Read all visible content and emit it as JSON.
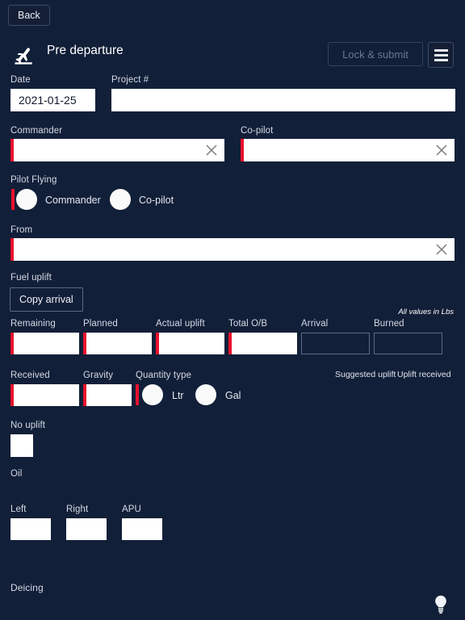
{
  "nav": {
    "back_label": "Back"
  },
  "header": {
    "icon": "flight-takeoff-icon",
    "title": "Pre departure",
    "lock_submit_label": "Lock & submit",
    "menu_icon": "hamburger-menu-icon"
  },
  "form": {
    "date": {
      "label": "Date",
      "value": "2021-01-25",
      "placeholder": ""
    },
    "project": {
      "label": "Project #",
      "value": "",
      "placeholder": ""
    },
    "commander": {
      "label": "Commander",
      "value": "",
      "placeholder": "",
      "clear_icon": "close-icon"
    },
    "copilot": {
      "label": "Co-pilot",
      "value": "",
      "placeholder": "",
      "clear_icon": "close-icon"
    },
    "pilot_flying": {
      "label": "Pilot Flying",
      "options": [
        {
          "label": "Commander",
          "selected": false
        },
        {
          "label": "Co-pilot",
          "selected": false
        }
      ]
    },
    "from": {
      "label": "From",
      "value": "",
      "placeholder": "",
      "clear_icon": "close-icon"
    }
  },
  "fuel": {
    "section_label": "Fuel uplift",
    "copy_arrival_label": "Copy arrival",
    "units_note": "All values in Lbs",
    "fields": [
      {
        "label": "Remaining",
        "value": "",
        "readonly": false
      },
      {
        "label": "Planned",
        "value": "",
        "readonly": false
      },
      {
        "label": "Actual uplift",
        "value": "",
        "readonly": false
      },
      {
        "label": "Total O/B",
        "value": "",
        "readonly": false
      },
      {
        "label": "Arrival",
        "value": "",
        "readonly": true
      },
      {
        "label": "Burned",
        "value": "",
        "readonly": true
      }
    ],
    "received": {
      "label": "Received",
      "value": ""
    },
    "gravity": {
      "label": "Gravity",
      "value": ""
    },
    "quantity_type": {
      "label": "Quantity type",
      "options": [
        {
          "label": "Ltr",
          "selected": false
        },
        {
          "label": "Gal",
          "selected": false
        }
      ]
    },
    "suggested_uplift_label": "Suggested uplift",
    "uplift_received_label": "Uplift received",
    "no_uplift": {
      "label": "No uplift",
      "checked": false
    }
  },
  "oil": {
    "section_label": "Oil",
    "fields": [
      {
        "label": "Left",
        "value": ""
      },
      {
        "label": "Right",
        "value": ""
      },
      {
        "label": "APU",
        "value": ""
      }
    ]
  },
  "deicing": {
    "section_label": "Deicing"
  },
  "fab": {
    "icon": "lightbulb-icon"
  },
  "colors": {
    "background": "#121f38",
    "required_marker": "#e8112d",
    "field_fill": "#ffffff",
    "text_primary": "#ffffff",
    "text_label": "#d4dae6",
    "disabled_text": "#6c7690",
    "border": "#5d6a86"
  }
}
